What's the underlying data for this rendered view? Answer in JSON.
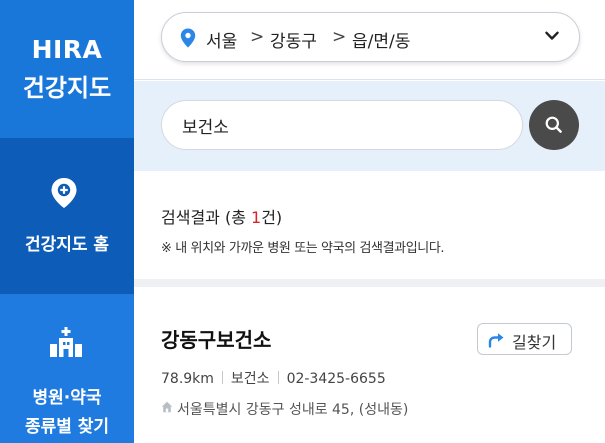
{
  "sidebar": {
    "logo_en": "HIRA",
    "logo_ko": "건강지도",
    "items": [
      {
        "label": "건강지도 홈",
        "icon": "map-pin-plus-icon"
      },
      {
        "label_line1": "병원·약국",
        "label_line2": "종류별 찾기",
        "icon": "hospital-building-icon"
      }
    ]
  },
  "region": {
    "icon": "location-pin-icon",
    "crumbs": [
      "서울",
      "강동구",
      "읍/면/동"
    ],
    "separator": ">"
  },
  "search": {
    "value": "보건소",
    "button_icon": "search-icon"
  },
  "results": {
    "summary_prefix": "검색결과 (총 ",
    "summary_count": "1",
    "summary_suffix": "건)",
    "note": "※ 내 위치와 가까운 병원 또는 약국의 검색결과입니다.",
    "items": [
      {
        "name": "강동구보건소",
        "directions_label": "길찾기",
        "distance": "78.9km",
        "type": "보건소",
        "phone": "02-3425-6655",
        "address": "서울특별시 강동구 성내로 45, (성내동)"
      }
    ]
  },
  "colors": {
    "sidebar_bg": "#1f7be0",
    "sidebar_active": "#0d5db8",
    "search_band": "#e6f0fa",
    "accent_count": "#d8242a",
    "pin_blue": "#2a87e8"
  }
}
